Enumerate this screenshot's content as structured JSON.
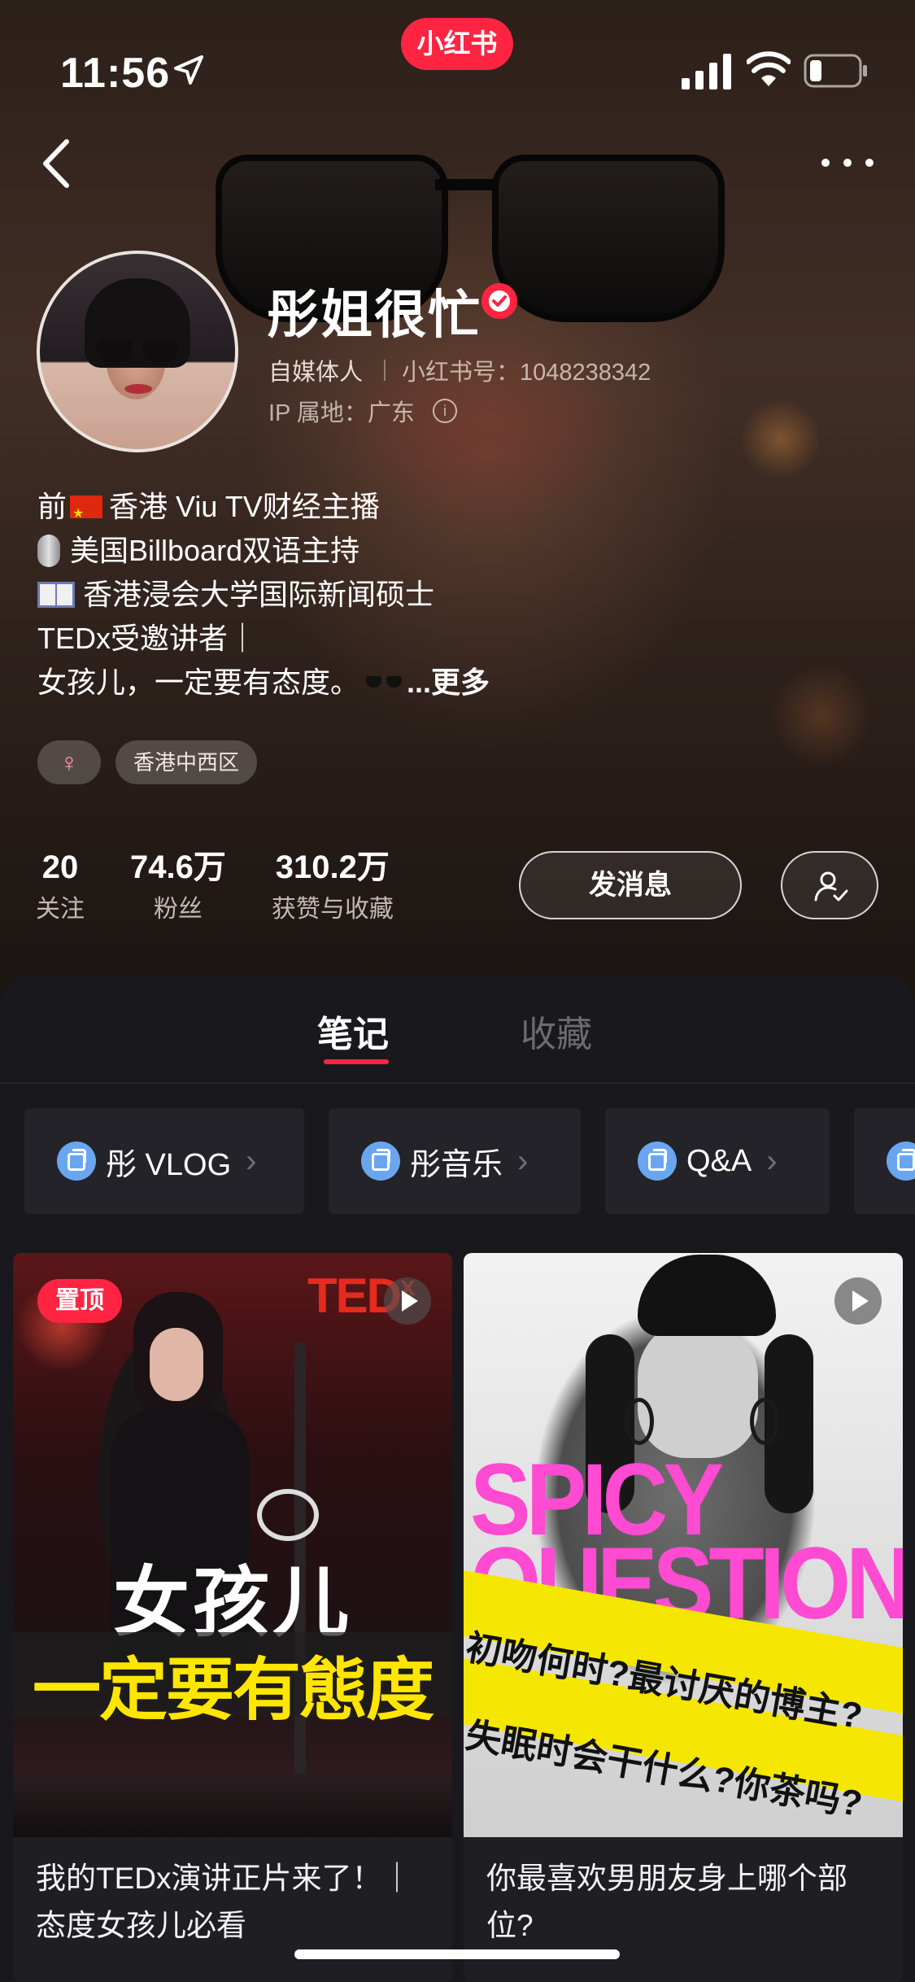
{
  "status_bar": {
    "time": "11:56",
    "app_badge": "小红书"
  },
  "profile": {
    "name": "彤姐很忙",
    "role": "自媒体人",
    "redbook_id": "小红书号：1048238342",
    "ip_location": "IP 属地：广东",
    "bio": {
      "line1_prefix": "前",
      "line1_rest": "香港 Viu TV财经主播",
      "line2": "美国Billboard双语主持",
      "line3": "香港浸会大学国际新闻硕士",
      "line4": "TEDx受邀讲者｜",
      "line5": "女孩儿，一定要有态度。",
      "more": "...更多"
    },
    "tags": {
      "gender": "♀",
      "location": "香港中西区"
    },
    "stats": [
      {
        "value": "20",
        "label": "关注"
      },
      {
        "value": "74.6万",
        "label": "粉丝"
      },
      {
        "value": "310.2万",
        "label": "获赞与收藏"
      }
    ],
    "message_button": "发消息"
  },
  "tabs": {
    "notes": "笔记",
    "collections": "收藏"
  },
  "albums": [
    "彤 VLOG",
    "彤音乐",
    "Q&A"
  ],
  "notes": [
    {
      "badge": "置顶",
      "cover_brand": "TED",
      "cover_brand_suffix": "x",
      "cover_line1": "女孩儿",
      "cover_line2": "一定要有態度",
      "title": "我的TEDx演讲正片来了！｜态度女孩儿必看"
    },
    {
      "cover_headline_1": "SPICY",
      "cover_headline_2": "QUESTIONS",
      "cover_strip_1": "初吻何时?最讨厌的博主?",
      "cover_strip_2": "失眠时会干什么?你茶吗?",
      "title": "你最喜欢男朋友身上哪个部位?"
    }
  ],
  "colors": {
    "brand_red": "#ff2442",
    "panel_bg": "#19181d",
    "album_icon": "#6aa6f0"
  }
}
